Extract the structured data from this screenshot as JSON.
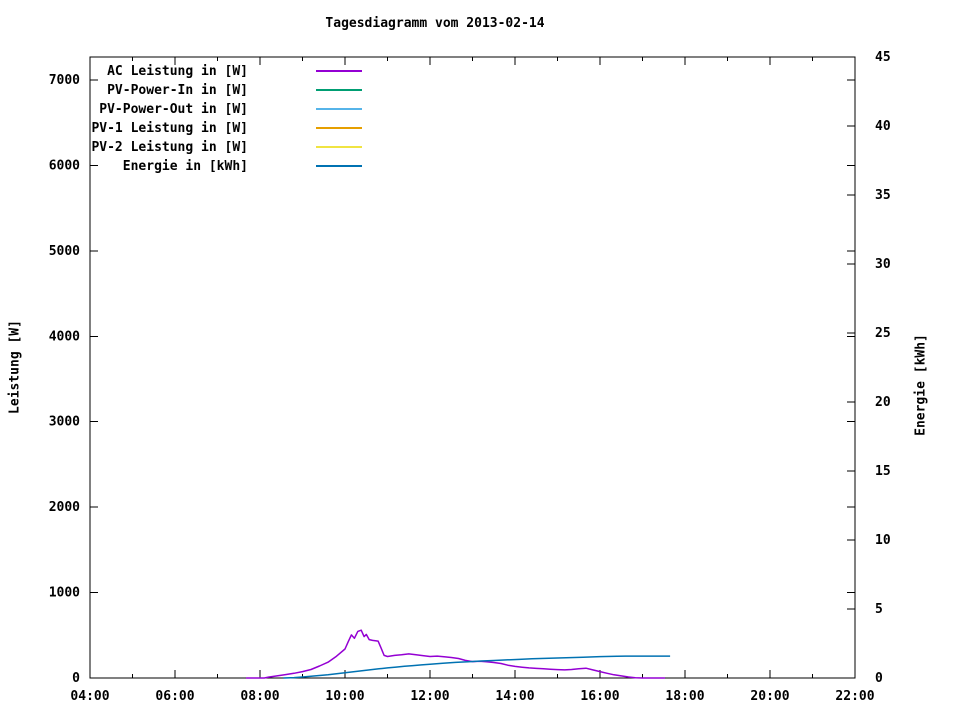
{
  "title": "Tagesdiagramm vom 2013-02-14",
  "colors": {
    "background": "#ffffff",
    "axis": "#000000",
    "ac_leistung": "#9400D3",
    "pv_power_in": "#009E73",
    "pv_power_out": "#56B4E9",
    "pv1_leistung": "#E69F00",
    "pv2_leistung": "#F0E442",
    "energie": "#0072B2"
  },
  "chart_data": {
    "type": "line",
    "title": "Tagesdiagramm vom 2013-02-14",
    "grid": false,
    "legend_position": "top-left-inside",
    "x_axis": {
      "label": "",
      "unit": "time",
      "range_hours": [
        4,
        22
      ],
      "major_step_hours": 2,
      "minor_step_hours": 1,
      "tick_labels": [
        "04:00",
        "06:00",
        "08:00",
        "10:00",
        "12:00",
        "14:00",
        "16:00",
        "18:00",
        "20:00",
        "22:00"
      ]
    },
    "y_left": {
      "label": "Leistung [W]",
      "range": [
        0,
        7280
      ],
      "tick_labels": [
        0,
        1000,
        2000,
        3000,
        4000,
        5000,
        6000,
        7000
      ]
    },
    "y_right": {
      "label": "Energie [kWh]",
      "range": [
        0,
        45
      ],
      "tick_labels": [
        0,
        5,
        10,
        15,
        20,
        25,
        30,
        35,
        40,
        45
      ]
    },
    "series": [
      {
        "name": "AC Leistung in [W]",
        "color": "#9400D3",
        "axis": "left",
        "points": [
          [
            7.67,
            0
          ],
          [
            8.1,
            0
          ],
          [
            8.2,
            10
          ],
          [
            8.4,
            25
          ],
          [
            8.6,
            40
          ],
          [
            8.8,
            55
          ],
          [
            9.0,
            75
          ],
          [
            9.2,
            100
          ],
          [
            9.4,
            140
          ],
          [
            9.6,
            185
          ],
          [
            9.8,
            255
          ],
          [
            10.0,
            340
          ],
          [
            10.08,
            430
          ],
          [
            10.15,
            505
          ],
          [
            10.22,
            465
          ],
          [
            10.3,
            545
          ],
          [
            10.38,
            560
          ],
          [
            10.45,
            485
          ],
          [
            10.5,
            510
          ],
          [
            10.57,
            450
          ],
          [
            10.65,
            440
          ],
          [
            10.78,
            432
          ],
          [
            10.85,
            350
          ],
          [
            10.92,
            265
          ],
          [
            11.0,
            252
          ],
          [
            11.17,
            265
          ],
          [
            11.33,
            272
          ],
          [
            11.5,
            282
          ],
          [
            11.67,
            272
          ],
          [
            11.83,
            262
          ],
          [
            12.0,
            252
          ],
          [
            12.17,
            256
          ],
          [
            12.33,
            248
          ],
          [
            12.5,
            240
          ],
          [
            12.67,
            228
          ],
          [
            12.83,
            206
          ],
          [
            13.0,
            192
          ],
          [
            13.17,
            196
          ],
          [
            13.33,
            190
          ],
          [
            13.5,
            182
          ],
          [
            13.67,
            170
          ],
          [
            13.83,
            150
          ],
          [
            14.0,
            136
          ],
          [
            14.17,
            126
          ],
          [
            14.33,
            118
          ],
          [
            14.5,
            112
          ],
          [
            14.67,
            108
          ],
          [
            14.83,
            103
          ],
          [
            15.0,
            98
          ],
          [
            15.17,
            95
          ],
          [
            15.33,
            100
          ],
          [
            15.5,
            108
          ],
          [
            15.67,
            115
          ],
          [
            15.83,
            95
          ],
          [
            16.0,
            75
          ],
          [
            16.17,
            55
          ],
          [
            16.33,
            38
          ],
          [
            16.5,
            25
          ],
          [
            16.67,
            12
          ],
          [
            16.83,
            4
          ],
          [
            17.0,
            0
          ],
          [
            17.53,
            0
          ]
        ]
      },
      {
        "name": "PV-Power-In in [W]",
        "color": "#009E73",
        "axis": "left",
        "points": []
      },
      {
        "name": "PV-Power-Out in [W]",
        "color": "#56B4E9",
        "axis": "left",
        "points": []
      },
      {
        "name": "PV-1 Leistung in [W]",
        "color": "#E69F00",
        "axis": "left",
        "points": []
      },
      {
        "name": "PV-2 Leistung in [W]",
        "color": "#F0E442",
        "axis": "left",
        "points": []
      },
      {
        "name": "Energie in [kWh]",
        "color": "#0072B2",
        "axis": "right",
        "points": [
          [
            8.55,
            0.0
          ],
          [
            8.8,
            0.03
          ],
          [
            9.0,
            0.07
          ],
          [
            9.2,
            0.12
          ],
          [
            9.4,
            0.18
          ],
          [
            9.6,
            0.24
          ],
          [
            9.8,
            0.31
          ],
          [
            10.0,
            0.38
          ],
          [
            10.2,
            0.45
          ],
          [
            10.4,
            0.53
          ],
          [
            10.6,
            0.6
          ],
          [
            10.8,
            0.67
          ],
          [
            11.0,
            0.73
          ],
          [
            11.2,
            0.79
          ],
          [
            11.4,
            0.85
          ],
          [
            11.6,
            0.9
          ],
          [
            11.8,
            0.95
          ],
          [
            12.0,
            1.0
          ],
          [
            12.3,
            1.07
          ],
          [
            12.6,
            1.13
          ],
          [
            12.9,
            1.18
          ],
          [
            13.2,
            1.23
          ],
          [
            13.5,
            1.27
          ],
          [
            13.8,
            1.31
          ],
          [
            14.1,
            1.35
          ],
          [
            14.4,
            1.39
          ],
          [
            14.8,
            1.43
          ],
          [
            15.2,
            1.47
          ],
          [
            15.6,
            1.5
          ],
          [
            16.0,
            1.55
          ],
          [
            16.4,
            1.57
          ],
          [
            16.6,
            1.59
          ],
          [
            17.65,
            1.59
          ]
        ]
      }
    ]
  }
}
